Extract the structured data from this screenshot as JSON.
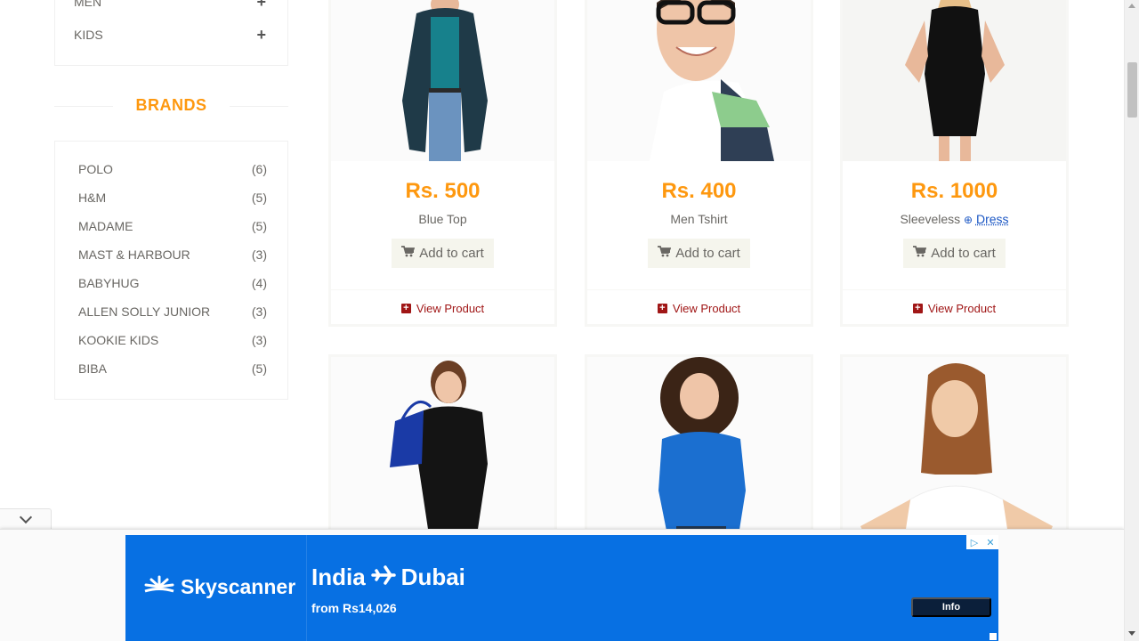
{
  "sidebar": {
    "categories": [
      {
        "label": "MEN"
      },
      {
        "label": "KIDS"
      }
    ],
    "brands_title": "BRANDS",
    "brands": [
      {
        "name": "POLO",
        "count": "(6)"
      },
      {
        "name": "H&M",
        "count": "(5)"
      },
      {
        "name": "MADAME",
        "count": "(5)"
      },
      {
        "name": "MAST & HARBOUR",
        "count": "(3)"
      },
      {
        "name": "BABYHUG",
        "count": "(4)"
      },
      {
        "name": "ALLEN SOLLY JUNIOR",
        "count": "(3)"
      },
      {
        "name": "KOOKIE KIDS",
        "count": "(3)"
      },
      {
        "name": "BIBA",
        "count": "(5)"
      }
    ]
  },
  "products": [
    {
      "price": "Rs. 500",
      "name": "Blue Top",
      "tag": "",
      "cart_label": "Add to cart",
      "view_label": "View Product"
    },
    {
      "price": "Rs. 400",
      "name": "Men Tshirt",
      "tag": "",
      "cart_label": "Add to cart",
      "view_label": "View Product"
    },
    {
      "price": "Rs. 1000",
      "name": "Sleeveless",
      "tag": "Dress",
      "cart_label": "Add to cart",
      "view_label": "View Product"
    }
  ],
  "ad": {
    "brand": "Skyscanner",
    "route_from": "India",
    "route_to": "Dubai",
    "fare": "from Rs14,026",
    "cta": "Info"
  },
  "colors": {
    "accent_orange": "#FE980F",
    "view_red": "#a01616",
    "ad_blue": "#0770E3"
  }
}
